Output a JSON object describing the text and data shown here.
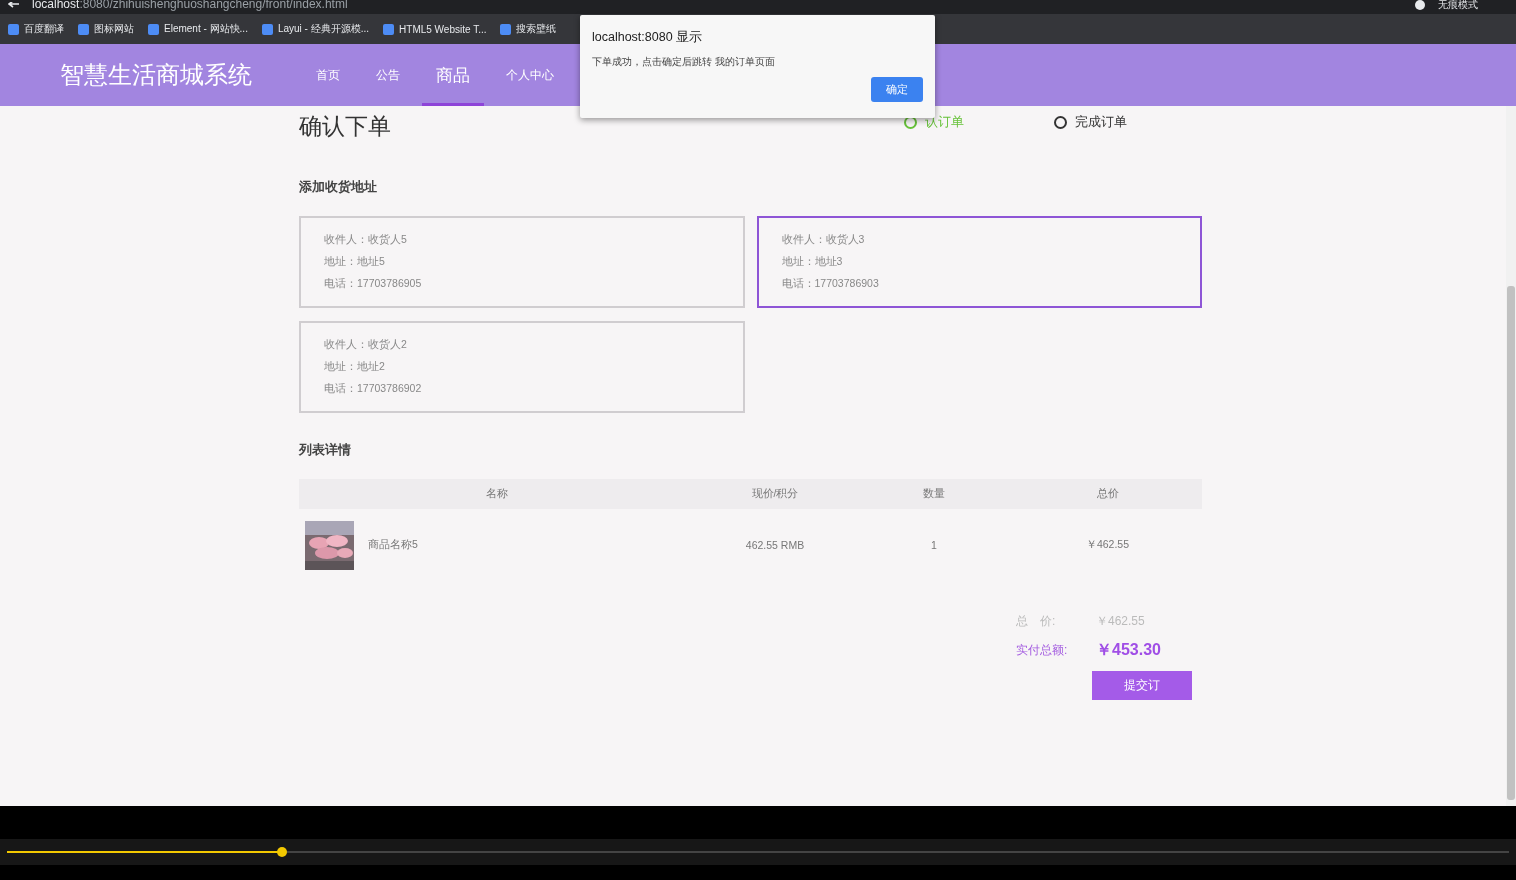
{
  "browser": {
    "url_host": "localhost",
    "url_path": ":8080/zhihuishenghuoshangcheng/front/index.html",
    "profile": "无痕模式",
    "bookmarks": [
      "百度翻译",
      "图标网站",
      "Element - 网站快...",
      "Layui - 经典开源模...",
      "HTML5 Website T...",
      "搜索壁纸"
    ]
  },
  "header": {
    "title": "智慧生活商城系统",
    "nav": [
      {
        "label": "首页",
        "selected": false
      },
      {
        "label": "公告",
        "selected": false
      },
      {
        "label": "商品",
        "selected": true
      },
      {
        "label": "个人中心",
        "selected": false
      }
    ]
  },
  "page_title": "确认下单",
  "steps": [
    {
      "label": "认订单",
      "done": true
    },
    {
      "label": "完成订单",
      "done": false
    }
  ],
  "address_section": {
    "title": "添加收货地址",
    "addresses": [
      {
        "receiver": "收件人：收货人5",
        "address": "地址：地址5",
        "phone": "电话：17703786905",
        "selected": false
      },
      {
        "receiver": "收件人：收货人3",
        "address": "地址：地址3",
        "phone": "电话：17703786903",
        "selected": true
      },
      {
        "receiver": "收件人：收货人2",
        "address": "地址：地址2",
        "phone": "电话：17703786902",
        "selected": false
      }
    ]
  },
  "list_section": {
    "title": "列表详情",
    "columns": [
      "名称",
      "现价/积分",
      "数量",
      "总价"
    ],
    "rows": [
      {
        "name": "商品名称5",
        "price": "462.55 RMB",
        "quantity": "1",
        "total": "￥462.55"
      }
    ]
  },
  "summary": {
    "total_label": "总　价:",
    "total": "￥462.55",
    "paid_label": "实付总额:",
    "paid": "￥453.30",
    "submit": "提交订"
  },
  "dialog": {
    "title": "localhost:8080 显示",
    "message": "下单成功，点击确定后跳转 我的订单页面",
    "ok": "确定"
  },
  "player": {
    "level": 0.183
  }
}
